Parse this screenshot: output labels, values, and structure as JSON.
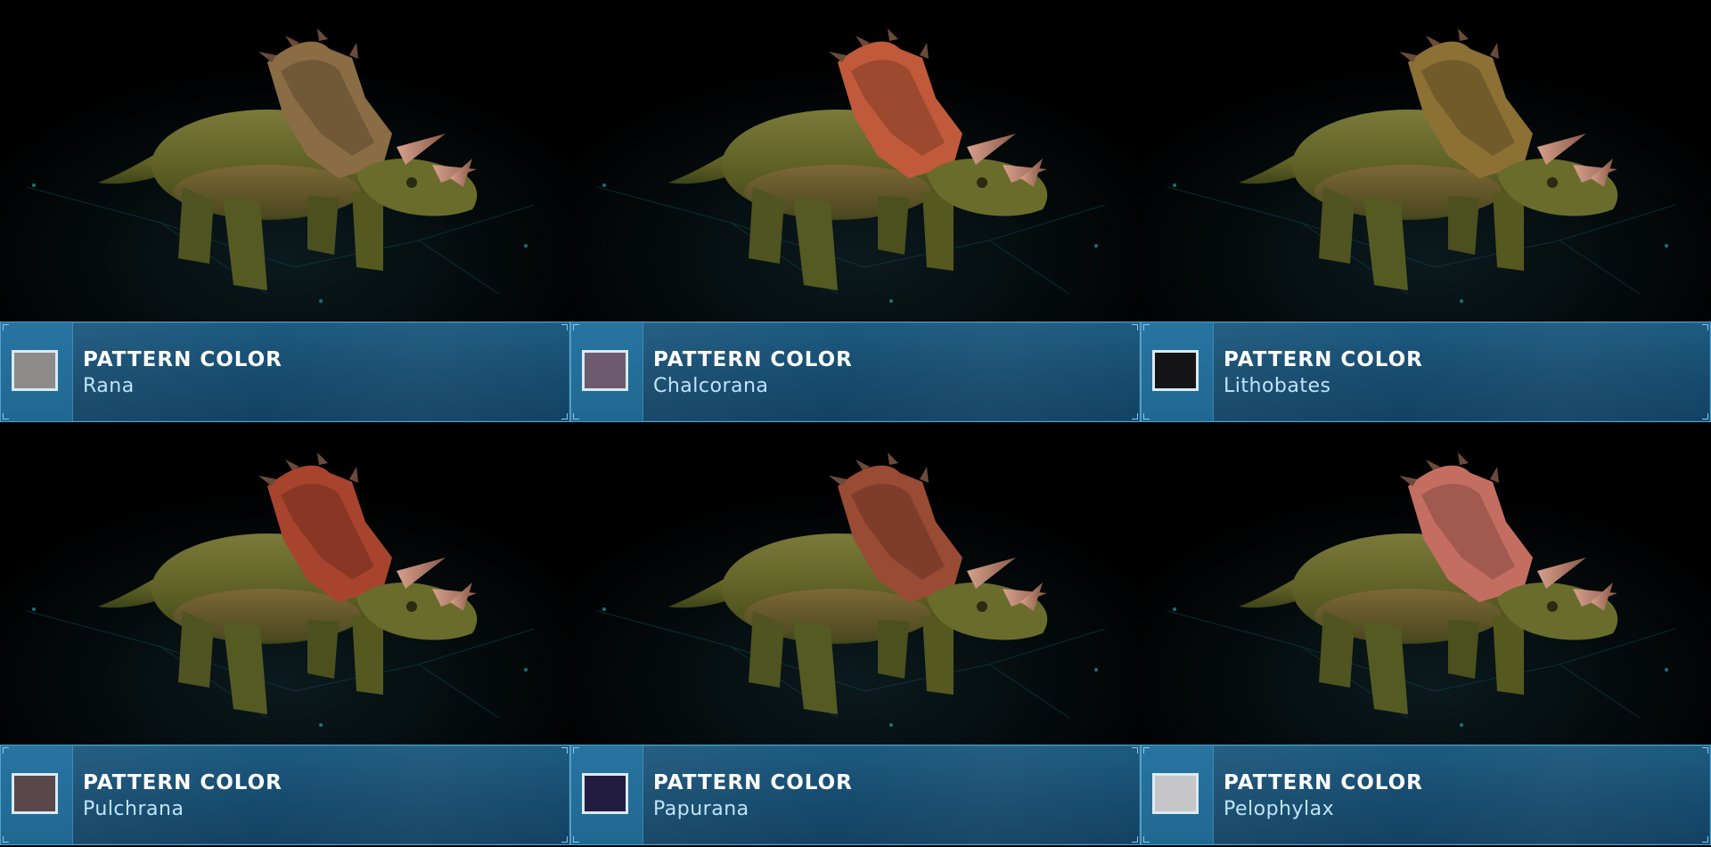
{
  "cards": [
    {
      "title": "PATTERN COLOR",
      "name": "Rana",
      "swatch": "#8d8c8a",
      "frill": "#8a6d44"
    },
    {
      "title": "PATTERN COLOR",
      "name": "Chalcorana",
      "swatch": "#6d5a6e",
      "frill": "#c05a3a"
    },
    {
      "title": "PATTERN COLOR",
      "name": "Lithobates",
      "swatch": "#141416",
      "frill": "#8c7034"
    },
    {
      "title": "PATTERN COLOR",
      "name": "Pulchrana",
      "swatch": "#5a474a",
      "frill": "#a8442d"
    },
    {
      "title": "PATTERN COLOR",
      "name": "Papurana",
      "swatch": "#221d40",
      "frill": "#9a4b34"
    },
    {
      "title": "PATTERN COLOR",
      "name": "Pelophylax",
      "swatch": "#c6c5c8",
      "frill": "#c46e62"
    }
  ]
}
